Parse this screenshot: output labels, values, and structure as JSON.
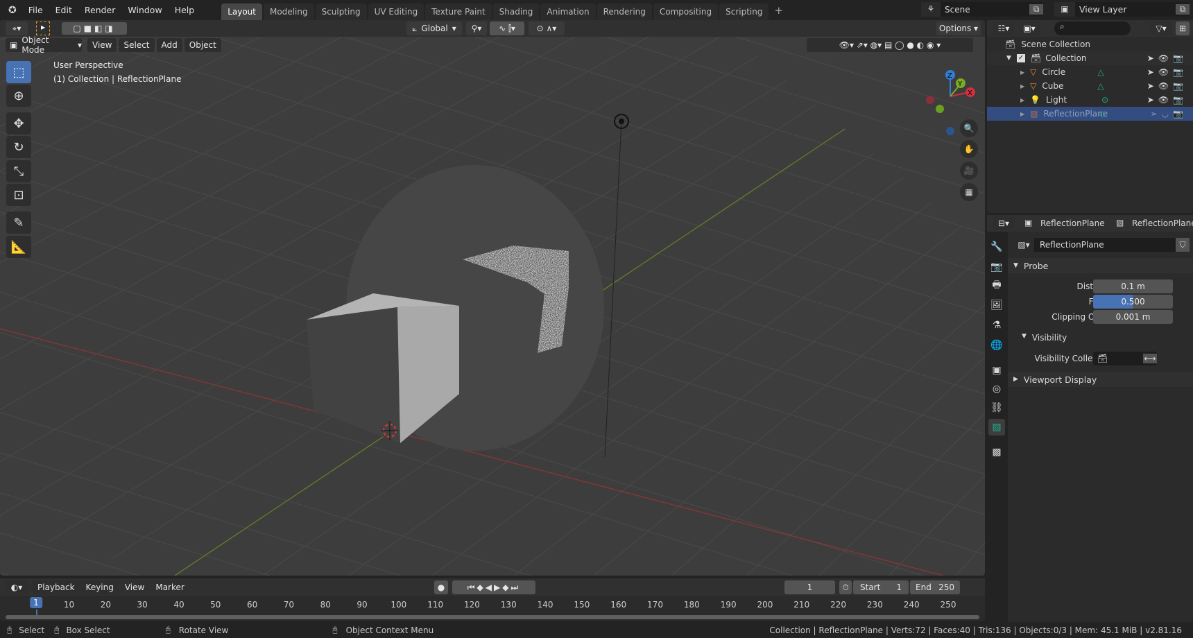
{
  "menu": [
    "File",
    "Edit",
    "Render",
    "Window",
    "Help"
  ],
  "workspaces": [
    "Layout",
    "Modeling",
    "Sculpting",
    "UV Editing",
    "Texture Paint",
    "Shading",
    "Animation",
    "Rendering",
    "Compositing",
    "Scripting"
  ],
  "active_workspace": "Layout",
  "scene": "Scene",
  "view_layer": "View Layer",
  "tool_header": {
    "transform": "Global",
    "options": "Options"
  },
  "viewport_header": {
    "mode": "Object Mode",
    "menus": [
      "View",
      "Select",
      "Add",
      "Object"
    ]
  },
  "viewport": {
    "perspective": "User Perspective",
    "context": "(1) Collection | ReflectionPlane",
    "axes": [
      "X",
      "Y",
      "Z"
    ],
    "colors": {
      "x_axis": "#9a3b3b",
      "y_axis": "#6b8a2a",
      "bg": "#3d3d3d"
    }
  },
  "outliner": {
    "scene_collection": "Scene Collection",
    "collection": "Collection",
    "items": [
      {
        "name": "Circle",
        "icon": "mesh-icon"
      },
      {
        "name": "Cube",
        "icon": "mesh-icon"
      },
      {
        "name": "Light",
        "icon": "light-icon"
      },
      {
        "name": "ReflectionPlane",
        "icon": "lightprobe-icon",
        "selected": true
      }
    ]
  },
  "properties": {
    "object": "ReflectionPlane",
    "data": "ReflectionPlane",
    "datablock": "ReflectionPlane",
    "probe": "Probe",
    "distance_label": "Distance",
    "distance": "0.1 m",
    "falloff_label": "Falloff",
    "falloff": "0.500",
    "falloff_fraction": 0.5,
    "clip_label": "Clipping Offset",
    "clip": "0.001 m",
    "visibility": "Visibility",
    "vis_coll_label": "Visibility Collection",
    "viewport_display": "Viewport Display",
    "accent": "#4772b3"
  },
  "timeline": {
    "menus": [
      "Playback",
      "Keying",
      "View",
      "Marker"
    ],
    "current": "1",
    "start_label": "Start",
    "start": "1",
    "end_label": "End",
    "end": "250",
    "ticks": [
      "1",
      "10",
      "20",
      "30",
      "40",
      "50",
      "60",
      "70",
      "80",
      "90",
      "100",
      "110",
      "120",
      "130",
      "140",
      "150",
      "160",
      "170",
      "180",
      "190",
      "200",
      "210",
      "220",
      "230",
      "240",
      "250"
    ]
  },
  "status": {
    "select": "Select",
    "box_select": "Box Select",
    "rotate": "Rotate View",
    "context_menu": "Object Context Menu",
    "info": "Collection | ReflectionPlane | Verts:72 | Faces:40 | Tris:136 | Objects:0/3 | Mem: 45.1 MiB | v2.81.16"
  }
}
